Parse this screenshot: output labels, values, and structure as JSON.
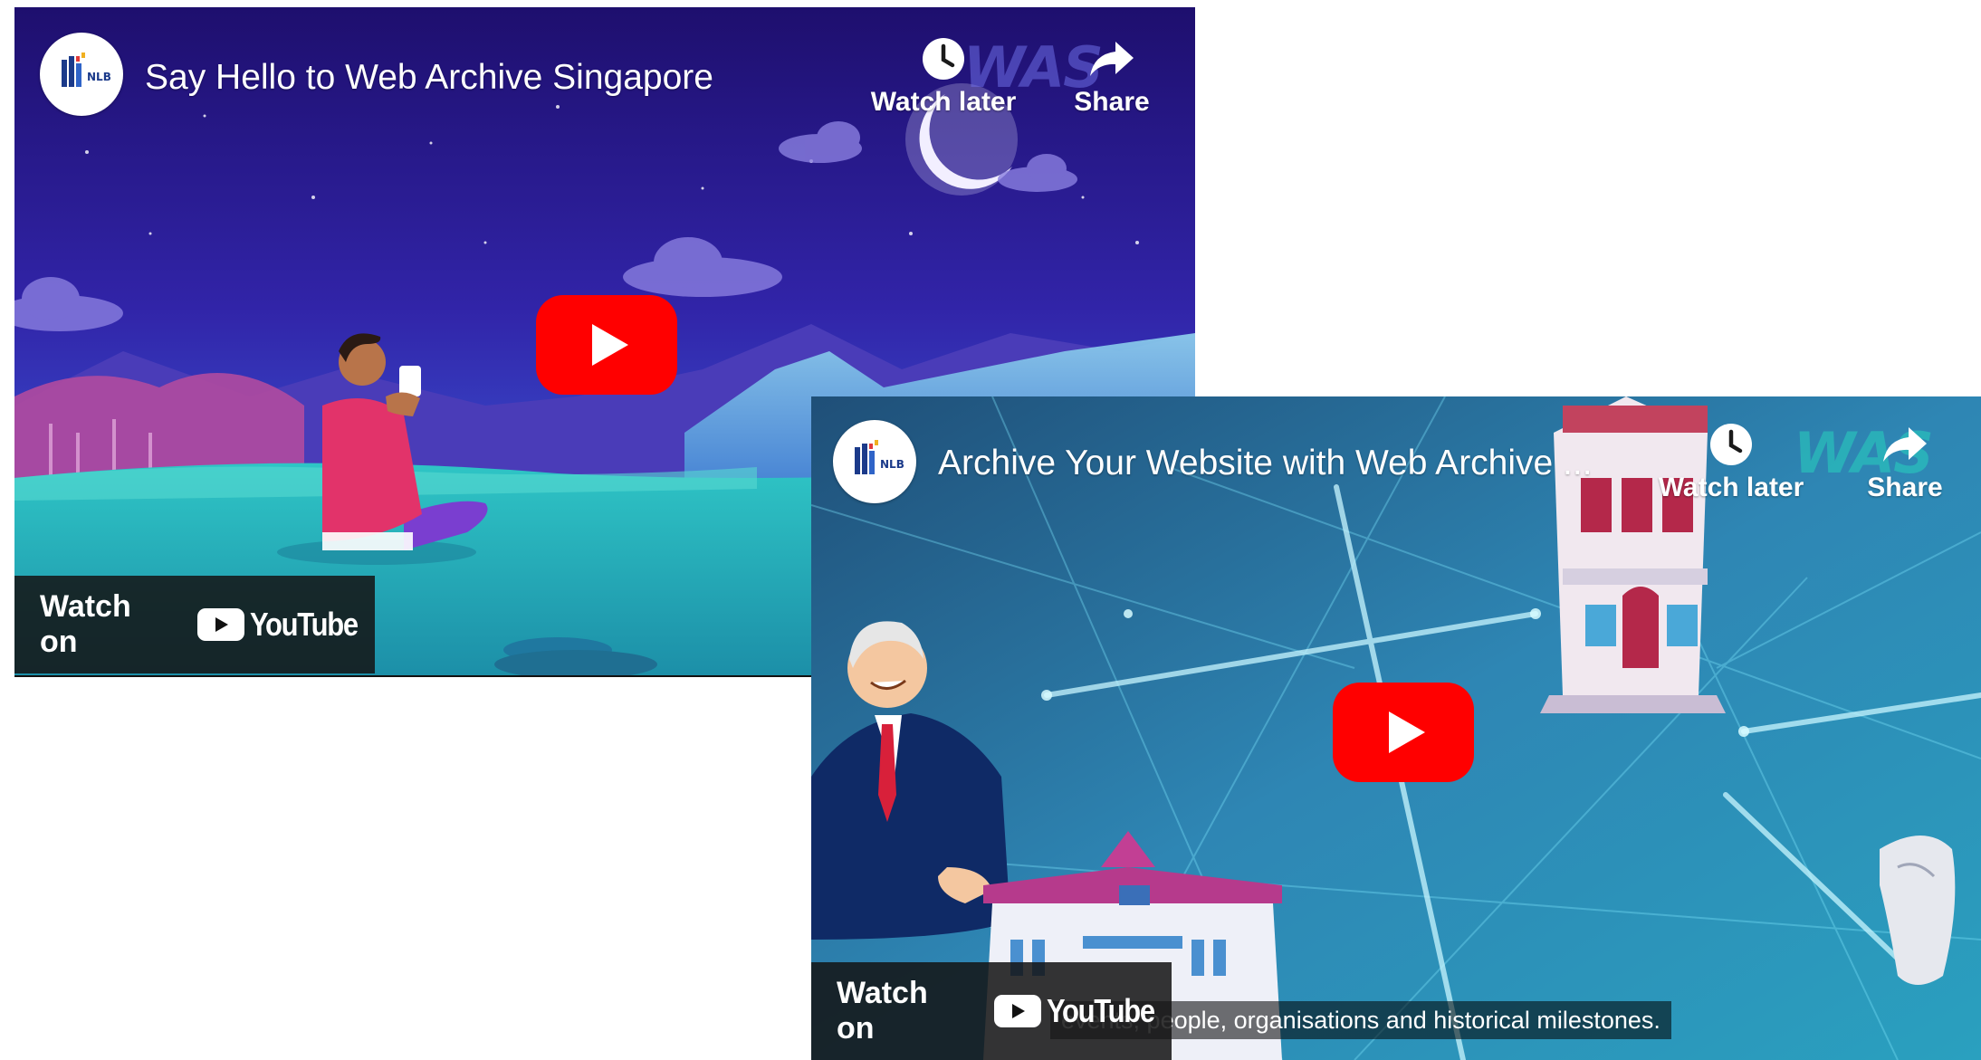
{
  "videos": [
    {
      "title": "Say Hello to Web Archive Singapore",
      "channel_logo_text": "NLB",
      "brand_watermark": "WAS",
      "watch_later_label": "Watch later",
      "share_label": "Share",
      "watch_on_label": "Watch on",
      "youtube_wordmark": "YouTube"
    },
    {
      "title": "Archive Your Website with Web Archive ...",
      "channel_logo_text": "NLB",
      "brand_watermark": "WAS",
      "watch_later_label": "Watch later",
      "share_label": "Share",
      "watch_on_label": "Watch on",
      "youtube_wordmark": "YouTube",
      "caption": "events, people, organisations and historical milestones."
    }
  ],
  "colors": {
    "youtube_red": "#ff0000",
    "night_sky": "#2a1a8c",
    "teal_scene": "#2f8fb0"
  },
  "icons": [
    "clock-icon",
    "share-arrow-icon",
    "play-icon",
    "youtube-logo-icon",
    "nlb-logo-icon"
  ]
}
